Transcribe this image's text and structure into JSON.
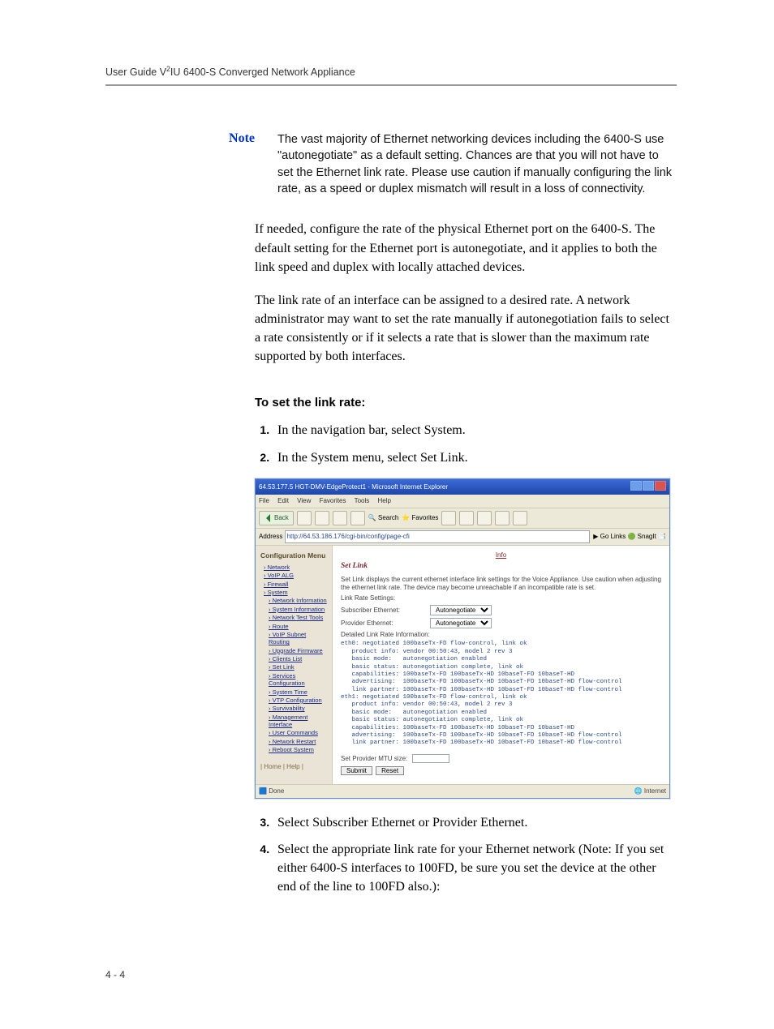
{
  "header": "User Guide V²IU 6400-S Converged Network Appliance",
  "note": {
    "label": "Note",
    "text": "The vast majority of Ethernet networking devices including the 6400-S use \"autonegotiate\" as a default setting. Chances are that you will not have to set the Ethernet link rate. Please use caution if manually configuring the link rate, as a speed or duplex mismatch will result in a loss of connectivity."
  },
  "para1": "If needed, configure the rate of the physical Ethernet port on the 6400-S. The default setting for the Ethernet port is autonegotiate, and it applies to both the link speed and duplex with locally attached devices.",
  "para2": "The link rate of an interface can be assigned to a desired rate. A network administrator may want to set the rate manually if autonegotiation fails to select a rate consistently or if it selects a rate that is slower than the maximum rate supported by both interfaces.",
  "subhead": "To set the link rate:",
  "steps_a": [
    "In the navigation bar, select System.",
    "In the System menu, select Set Link."
  ],
  "steps_b": [
    "Select Subscriber Ethernet or Provider Ethernet.",
    "Select the appropriate link rate for your Ethernet network (Note: If you set either 6400-S interfaces to 100FD, be sure you set the device at the other end of the line to 100FD also.):"
  ],
  "screenshot": {
    "title": "64.53.177.5 HGT-DMV-EdgeProtect1 - Microsoft Internet Explorer",
    "menu": [
      "File",
      "Edit",
      "View",
      "Favorites",
      "Tools",
      "Help"
    ],
    "back_label": "Back",
    "toolbar_search": "Search",
    "toolbar_fav": "Favorites",
    "address_label": "Address",
    "address_url": "http://64.53.186.176/cgi-bin/config/page-cfi",
    "go_label": "Go",
    "links_label": "Links",
    "snagit_label": "SnagIt",
    "sidebar": {
      "title": "Configuration Menu",
      "items": [
        {
          "label": "Network",
          "sub": false
        },
        {
          "label": "VoIP ALG",
          "sub": false
        },
        {
          "label": "Firewall",
          "sub": false
        },
        {
          "label": "System",
          "sub": false
        },
        {
          "label": "Network Information",
          "sub": true
        },
        {
          "label": "System Information",
          "sub": true
        },
        {
          "label": "Network Test Tools",
          "sub": true
        },
        {
          "label": "Route",
          "sub": true
        },
        {
          "label": "VoIP Subnet Routing",
          "sub": true
        },
        {
          "label": "Upgrade Firmware",
          "sub": true
        },
        {
          "label": "Clients List",
          "sub": true
        },
        {
          "label": "Set Link",
          "sub": true
        },
        {
          "label": "Services Configuration",
          "sub": true
        },
        {
          "label": "System Time",
          "sub": true
        },
        {
          "label": "VTP Configuration",
          "sub": true
        },
        {
          "label": "Survivability",
          "sub": true
        },
        {
          "label": "Management Interface",
          "sub": true
        },
        {
          "label": "User Commands",
          "sub": true
        },
        {
          "label": "Network Restart",
          "sub": true
        },
        {
          "label": "Reboot System",
          "sub": true
        }
      ],
      "footer": "| Home | Help |"
    },
    "content": {
      "info_link": "Info",
      "heading": "Set Link",
      "intro": "Set Link displays the current ethernet interface link settings for the Voice Appliance. Use caution when adjusting the ethernet link rate. The device may become unreachable if an incompatible rate is set.",
      "rate_settings_label": "Link Rate Settings:",
      "sub_eth_label": "Subscriber Ethernet:",
      "prov_eth_label": "Provider Ethernet:",
      "select_value": "Autonegotiate",
      "detail_label": "Detailed Link Rate Information:",
      "detail_pre": "eth0: negotiated 100baseTx-FD flow-control, link ok\n   product info: vendor 00:50:43, model 2 rev 3\n   basic mode:   autonegotiation enabled\n   basic status: autonegotiation complete, link ok\n   capabilities: 100baseTx-FD 100baseTx-HD 10baseT-FD 10baseT-HD\n   advertising:  100baseTx-FD 100baseTx-HD 10baseT-FD 10baseT-HD flow-control\n   link partner: 100baseTx-FD 100baseTx-HD 10baseT-FD 10baseT-HD flow-control\neth1: negotiated 100baseTx-FD flow-control, link ok\n   product info: vendor 00:50:43, model 2 rev 3\n   basic mode:   autonegotiation enabled\n   basic status: autonegotiation complete, link ok\n   capabilities: 100baseTx-FD 100baseTx-HD 10baseT-FD 10baseT-HD\n   advertising:  100baseTx-FD 100baseTx-HD 10baseT-FD 10baseT-HD flow-control\n   link partner: 100baseTx-FD 100baseTx-HD 10baseT-FD 10baseT-HD flow-control",
      "mtu_label": "Set Provider MTU size:",
      "submit_label": "Submit",
      "reset_label": "Reset"
    },
    "status_left": "Done",
    "status_right": "Internet"
  },
  "page_num": "4 - 4"
}
